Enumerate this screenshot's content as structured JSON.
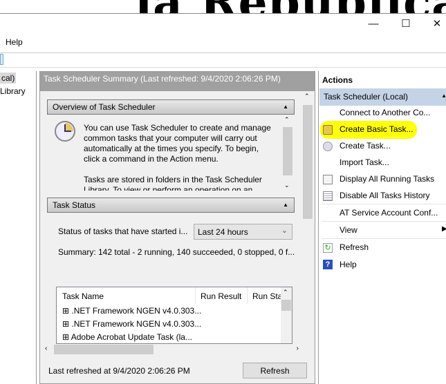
{
  "background": {
    "text": "la Republica"
  },
  "window": {
    "minimize": "—",
    "maximize": "☐",
    "close": "✕"
  },
  "menu": {
    "help": "Help"
  },
  "left_pane": {
    "items": [
      "cal)",
      "Library"
    ]
  },
  "summary": {
    "header": "Task Scheduler Summary (Last refreshed: 9/4/2020 2:06:26 PM)",
    "overview": {
      "title": "Overview of Task Scheduler",
      "text1": "You can use Task Scheduler to create and manage common tasks that your computer will carry out automatically at the times you specify. To begin, click a command in the Action menu.",
      "text2": "Tasks are stored in folders in the Task Scheduler Library. To view or perform an operation on an"
    },
    "status": {
      "title": "Task Status",
      "filter_label": "Status of tasks that have started i...",
      "filter_value": "Last 24 hours",
      "summary": "Summary: 142 total - 2 running, 140 succeeded, 0 stopped, 0 f...",
      "columns": [
        "Task Name",
        "Run Result",
        "Run Sta"
      ],
      "rows": [
        ".NET Framework NGEN v4.0.303...",
        ".NET Framework NGEN v4.0.303...",
        "Adobe Acrobat Update Task (la..."
      ]
    },
    "footer": {
      "last_refreshed": "Last refreshed at 9/4/2020 2:06:26 PM",
      "refresh": "Refresh"
    }
  },
  "actions": {
    "title": "Actions",
    "group": "Task Scheduler (Local)",
    "items": [
      {
        "label": "Connect to Another Co...",
        "icon": "none"
      },
      {
        "label": "Create Basic Task...",
        "icon": "basic-task-icon"
      },
      {
        "label": "Create Task...",
        "icon": "create-task-icon"
      },
      {
        "label": "Import Task...",
        "icon": "none"
      },
      {
        "label": "Display All Running Tasks",
        "icon": "running-tasks-icon"
      },
      {
        "label": "Disable All Tasks History",
        "icon": "history-icon"
      },
      {
        "label": "AT Service Account Conf...",
        "icon": "none"
      },
      {
        "label": "View",
        "icon": "none"
      },
      {
        "label": "Refresh",
        "icon": "refresh-icon"
      },
      {
        "label": "Help",
        "icon": "help-icon"
      }
    ],
    "highlight_color": "#ffff00"
  }
}
